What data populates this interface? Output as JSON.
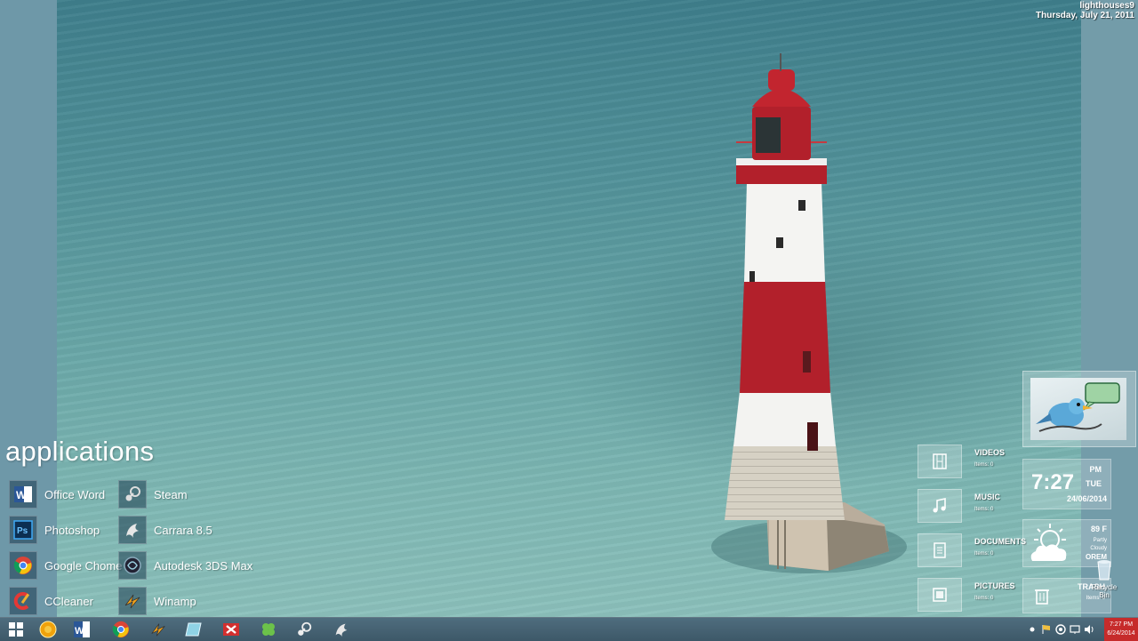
{
  "desktop": {
    "wallpaper_name": "lighthouses9",
    "date_long": "Thursday, July 21, 2011"
  },
  "applications": {
    "title": "applications",
    "items": [
      {
        "label": "Office Word",
        "icon": "word-icon"
      },
      {
        "label": "Photoshop",
        "icon": "photoshop-icon"
      },
      {
        "label": "Google Chome",
        "icon": "chrome-icon"
      },
      {
        "label": "CCleaner",
        "icon": "ccleaner-icon"
      },
      {
        "label": "Steam",
        "icon": "steam-icon"
      },
      {
        "label": "Carrara 8.5",
        "icon": "carrara-icon"
      },
      {
        "label": "Autodesk 3DS Max",
        "icon": "3dsmax-icon"
      },
      {
        "label": "Winamp",
        "icon": "winamp-icon"
      }
    ]
  },
  "libraries": {
    "items": [
      {
        "name": "VIDEOS",
        "count": "Items: 0",
        "icon": "film-icon"
      },
      {
        "name": "MUSIC",
        "count": "Items: 0",
        "icon": "music-note-icon"
      },
      {
        "name": "DOCUMENTS",
        "count": "Items: 0",
        "icon": "document-icon"
      },
      {
        "name": "PICTURES",
        "count": "Items: 0",
        "icon": "picture-icon"
      }
    ]
  },
  "clock_widget": {
    "time": "7:27",
    "ampm": "PM",
    "day": "TUE",
    "date": "24/06/2014"
  },
  "weather_widget": {
    "temp": "89 F",
    "condition_line1": "Partly",
    "condition_line2": "Cloudy",
    "city": "OREM"
  },
  "trash": {
    "label": "TRASH",
    "count": "Items: 0",
    "recycle_label": "Recycle Bin"
  },
  "taskbar": {
    "pinned": [
      "windows-start-icon",
      "media-center-icon",
      "word-icon",
      "chrome-icon",
      "winamp-icon",
      "notes-icon",
      "xmarks-icon",
      "clover-icon",
      "steam-icon",
      "carrara-icon"
    ],
    "clock_time": "7:27 PM",
    "clock_date": "6/24/2014"
  },
  "colors": {
    "taskbar": "#46606f",
    "tray_clock": "#c62b2b",
    "lighthouse_red": "#b2202b"
  }
}
